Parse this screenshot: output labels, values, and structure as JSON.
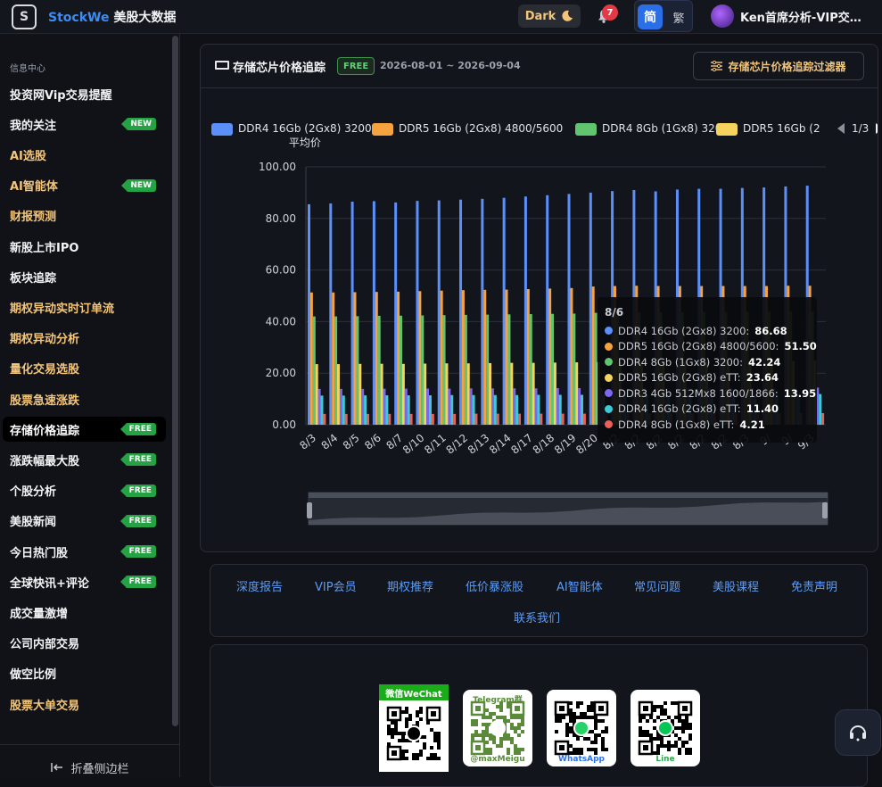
{
  "header": {
    "logo_letter": "S",
    "brand_name": "StockWe",
    "brand_suffix": "美股大数据",
    "theme_label": "Dark",
    "notification_count": "7",
    "lang_simplified": "简",
    "lang_traditional": "繁",
    "user_name": "Ken首席分析-VIP交…"
  },
  "sidebar": {
    "section_label": "信息中心",
    "items": [
      {
        "label": "投资网Vip交易提醒",
        "color": "white",
        "badge": ""
      },
      {
        "label": "我的关注",
        "color": "white",
        "badge": "NEW"
      },
      {
        "label": "AI选股",
        "color": "gold",
        "badge": ""
      },
      {
        "label": "AI智能体",
        "color": "gold",
        "badge": "NEW"
      },
      {
        "label": "财报预测",
        "color": "gold",
        "badge": ""
      },
      {
        "label": "新股上市IPO",
        "color": "white",
        "badge": ""
      },
      {
        "label": "板块追踪",
        "color": "white",
        "badge": ""
      },
      {
        "label": "期权异动实时订单流",
        "color": "gold",
        "badge": ""
      },
      {
        "label": "期权异动分析",
        "color": "gold",
        "badge": ""
      },
      {
        "label": "量化交易选股",
        "color": "gold",
        "badge": ""
      },
      {
        "label": "股票急速涨跌",
        "color": "gold",
        "badge": ""
      },
      {
        "label": "存储价格追踪",
        "color": "active",
        "badge": "FREE"
      },
      {
        "label": "涨跌幅最大股",
        "color": "white",
        "badge": "FREE"
      },
      {
        "label": "个股分析",
        "color": "white",
        "badge": "FREE"
      },
      {
        "label": "美股新闻",
        "color": "white",
        "badge": "FREE"
      },
      {
        "label": "今日热门股",
        "color": "white",
        "badge": "FREE"
      },
      {
        "label": "全球快讯+评论",
        "color": "white",
        "badge": "FREE"
      },
      {
        "label": "成交量激增",
        "color": "white",
        "badge": ""
      },
      {
        "label": "公司内部交易",
        "color": "white",
        "badge": ""
      },
      {
        "label": "做空比例",
        "color": "white",
        "badge": ""
      },
      {
        "label": "股票大单交易",
        "color": "gold",
        "badge": ""
      }
    ],
    "collapse_label": "折叠侧边栏"
  },
  "panel": {
    "title": "存储芯片价格追踪",
    "badge": "FREE",
    "date_range": "2026-08-01 ~ 2026-09-04",
    "filter_label": "存储芯片价格追踪过滤器",
    "legend_page": "1/3"
  },
  "chart_data": {
    "type": "bar",
    "ylim": [
      0,
      100
    ],
    "yticks": [
      "0.00",
      "20.00",
      "40.00",
      "60.00",
      "80.00",
      "100.00"
    ],
    "categories": [
      "8/3",
      "8/4",
      "8/5",
      "8/6",
      "8/7",
      "8/10",
      "8/11",
      "8/12",
      "8/13",
      "8/14",
      "8/17",
      "8/18",
      "8/19",
      "8/20",
      "8/21",
      "8/24",
      "8/25",
      "8/26",
      "8/27",
      "8/28",
      "8/31",
      "9/1",
      "9/2",
      "9/3"
    ],
    "tick_labels": [
      "8/3",
      "8/4",
      "8/5",
      "8/6",
      "8/7",
      "8/10",
      "8/11",
      "8/12",
      "8/13",
      "8/14",
      "8/17",
      "8/18",
      "8/19",
      "8/20",
      "8/2",
      "8/2",
      "8/2",
      "8/2",
      "8/2",
      "8/2",
      "8/3",
      "9/",
      "9/",
      "9/3"
    ],
    "series": [
      {
        "name": "DDR4 16Gb (2Gx8) 3200 平均价",
        "color": "#5b8ff9",
        "values": [
          85.5,
          85.8,
          86.5,
          86.68,
          86.2,
          86.8,
          87.0,
          87.3,
          87.6,
          88.0,
          88.5,
          89.0,
          89.5,
          90.0,
          90.6,
          91.0,
          90.5,
          91.2,
          91.5,
          91.5,
          91.8,
          92.0,
          92.4,
          92.7
        ]
      },
      {
        "name": "DDR5 16Gb (2Gx8) 4800/5600",
        "color": "#f6a23e",
        "values": [
          51.3,
          51.3,
          51.4,
          51.5,
          51.6,
          51.8,
          52.0,
          52.2,
          52.3,
          52.4,
          52.6,
          52.8,
          53.0,
          53.6,
          53.8,
          53.9,
          53.8,
          53.8,
          53.8,
          53.8,
          53.8,
          53.8,
          53.9,
          53.9
        ]
      },
      {
        "name": "DDR4 8Gb (1Gx8) 3200",
        "color": "#61c46e",
        "values": [
          42.0,
          42.0,
          42.1,
          42.24,
          42.3,
          42.4,
          42.5,
          42.6,
          42.7,
          42.8,
          42.9,
          43.0,
          43.1,
          43.4,
          43.5,
          43.6,
          43.6,
          43.6,
          43.7,
          43.7,
          43.8,
          43.8,
          43.9,
          44.0
        ]
      },
      {
        "name": "DDR5 16Gb (2Gx8) eTT",
        "color": "#f4d35e",
        "values": [
          23.5,
          23.5,
          23.6,
          23.64,
          23.6,
          23.7,
          23.8,
          23.8,
          23.9,
          24.0,
          24.0,
          24.1,
          24.2,
          24.3,
          24.3,
          24.4,
          24.4,
          24.5,
          24.5,
          24.6,
          24.6,
          24.7,
          24.7,
          24.8
        ]
      },
      {
        "name": "DDR3 4Gb 512Mx8 1600/1866",
        "color": "#7b68ee",
        "values": [
          13.9,
          13.9,
          13.9,
          13.95,
          14.0,
          14.0,
          14.0,
          14.1,
          14.1,
          14.1,
          14.1,
          14.2,
          14.2,
          14.2,
          14.2,
          14.3,
          14.3,
          14.3,
          14.3,
          14.3,
          14.4,
          14.4,
          14.4,
          14.4
        ]
      },
      {
        "name": "DDR4 16Gb (2Gx8) eTT",
        "color": "#3ccbd6",
        "values": [
          11.3,
          11.3,
          11.4,
          11.4,
          11.4,
          11.4,
          11.5,
          11.5,
          11.5,
          11.5,
          11.6,
          11.6,
          11.6,
          11.6,
          11.7,
          11.7,
          11.7,
          11.7,
          11.8,
          11.8,
          11.8,
          11.8,
          11.9,
          11.9
        ]
      },
      {
        "name": "DDR4 8Gb (1Gx8) eTT",
        "color": "#e8605a",
        "values": [
          4.2,
          4.2,
          4.2,
          4.21,
          4.2,
          4.2,
          4.2,
          4.3,
          4.3,
          4.3,
          4.3,
          4.3,
          4.3,
          4.4,
          4.4,
          4.4,
          4.4,
          4.4,
          4.4,
          4.5,
          4.5,
          4.5,
          4.5,
          4.5
        ]
      }
    ],
    "legend_visible": [
      {
        "label": "DDR4 16Gb (2Gx8) 3200",
        "label2": "平均价",
        "color": "#5b8ff9"
      },
      {
        "label": "DDR5 16Gb (2Gx8) 4800/5600",
        "label2": "",
        "color": "#f6a23e"
      },
      {
        "label": "DDR4 8Gb (1Gx8) 3200",
        "label2": "",
        "color": "#61c46e"
      },
      {
        "label": "DDR5 16Gb (2",
        "label2": "",
        "color": "#f4d35e"
      }
    ],
    "tooltip": {
      "title": "8/6",
      "rows": [
        {
          "label": "DDR4 16Gb (2Gx8) 3200:",
          "value": "86.68",
          "color": "#5b8ff9"
        },
        {
          "label": "DDR5 16Gb (2Gx8) 4800/5600:",
          "value": "51.50",
          "color": "#f6a23e"
        },
        {
          "label": "DDR4 8Gb (1Gx8) 3200:",
          "value": "42.24",
          "color": "#61c46e"
        },
        {
          "label": "DDR5 16Gb (2Gx8) eTT:",
          "value": "23.64",
          "color": "#f4d35e"
        },
        {
          "label": "DDR3 4Gb 512Mx8 1600/1866:",
          "value": "13.95",
          "color": "#7b68ee"
        },
        {
          "label": "DDR4 16Gb (2Gx8) eTT:",
          "value": "11.40",
          "color": "#3ccbd6"
        },
        {
          "label": "DDR4 8Gb (1Gx8) eTT:",
          "value": "4.21",
          "color": "#e8605a"
        }
      ]
    }
  },
  "footer": {
    "links": [
      "深度报告",
      "VIP会员",
      "期权推荐",
      "低价暴涨股",
      "AI智能体",
      "常见问题",
      "美股课程",
      "免责声明",
      "联系我们"
    ],
    "qr": [
      {
        "label": "微信WeChat",
        "sub": ""
      },
      {
        "label": "Telegram群",
        "sub": "@maxMeigu"
      },
      {
        "label": "",
        "sub": "WhatsApp"
      },
      {
        "label": "",
        "sub": "Line"
      }
    ]
  }
}
